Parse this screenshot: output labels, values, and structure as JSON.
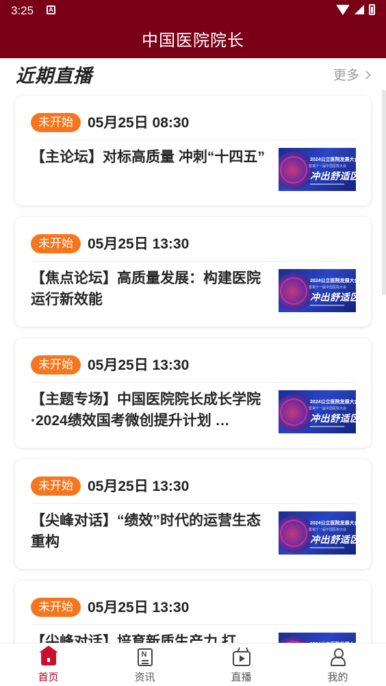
{
  "status_bar": {
    "time": "3:25",
    "notification_icon": "a-square-icon",
    "icons": [
      "wifi-icon",
      "signal-icon",
      "battery-icon"
    ]
  },
  "app_bar": {
    "title": "中国医院院长"
  },
  "section": {
    "title": "近期直播",
    "more_label": "更多"
  },
  "cards": [
    {
      "badge": "未开始",
      "time": "05月25日 08:30",
      "title": "【主论坛】对标高质量 冲刺“十四五”"
    },
    {
      "badge": "未开始",
      "time": "05月25日 13:30",
      "title": "【焦点论坛】高质量发展：构建医院运行新效能"
    },
    {
      "badge": "未开始",
      "time": "05月25日 13:30",
      "title": "【主题专场】中国医院院长成长学院·2024绩效国考微创提升计划 …"
    },
    {
      "badge": "未开始",
      "time": "05月25日 13:30",
      "title": "【尖峰对话】“绩效”时代的运营生态重构"
    },
    {
      "badge": "未开始",
      "time": "05月25日 13:30",
      "title": "【尖峰对话】培育新质生产力 打"
    }
  ],
  "thumbnail": {
    "line1": "2024公立医院发展大会",
    "line2": "暨第十一届中国医院大会",
    "line3": "冲出舒适区"
  },
  "colors": {
    "primary": "#7a0018",
    "badge": "#f6761f",
    "tab_active": "#b0001e"
  },
  "tabs": [
    {
      "label": "首页",
      "icon": "home-icon",
      "active": true
    },
    {
      "label": "资讯",
      "icon": "news-icon",
      "active": false
    },
    {
      "label": "直播",
      "icon": "live-tv-icon",
      "active": false
    },
    {
      "label": "我的",
      "icon": "profile-icon",
      "active": false
    }
  ]
}
